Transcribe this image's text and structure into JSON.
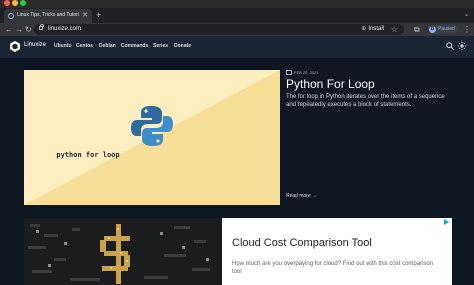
{
  "browser": {
    "tab_title": "Linux Tips, Tricks and Tutorials",
    "tab_close": "✕",
    "new_tab": "+",
    "tab_menu": "⌄",
    "back": "←",
    "forward": "→",
    "reload": "↻",
    "url": "linuxize.com",
    "install_label": "Install",
    "star": "☆",
    "extensions": "⧉",
    "profile_initial": "B",
    "profile_status": "Paused",
    "menu": "⋮"
  },
  "site": {
    "brand": "Linuxize",
    "nav": [
      "Ubuntu",
      "Centos",
      "Debian",
      "Commands",
      "Series",
      "Donate"
    ],
    "icons": [
      "search-icon",
      "sun-icon"
    ],
    "colors": {
      "header_bg": "#1b2432",
      "page_bg": "#0f1722",
      "accent": "#2f6aa0"
    }
  },
  "featured": {
    "image_caption": "python for loop",
    "date": "FEB 22, 2021",
    "title": "Python For Loop",
    "excerpt": "The for loop in Python iterates over the items of a sequence and repeatedly executes a block of statements.",
    "read_more": "Read more →"
  },
  "ad": {
    "title": "Cloud Cost Comparison Tool",
    "text": "How much are you overpaying for cloud? Find out with this cost comparison tool"
  }
}
